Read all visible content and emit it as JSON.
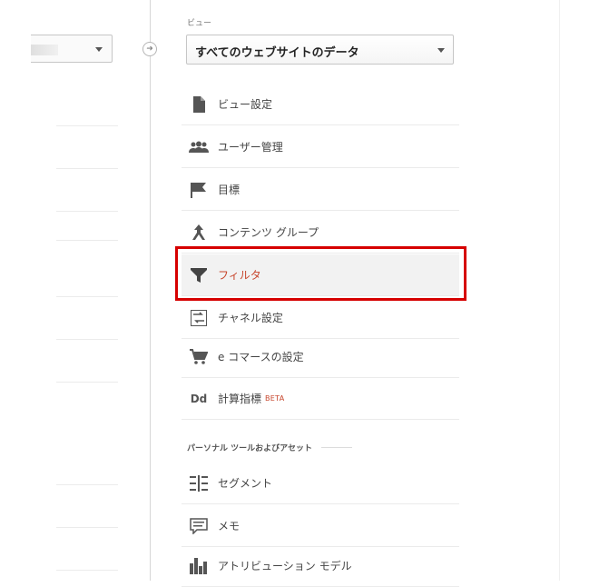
{
  "view_section": {
    "label": "ビュー",
    "selected_view": "すべてのウェブサイトのデータ"
  },
  "menu": [
    {
      "key": "view-settings",
      "label": "ビュー設定",
      "icon": "document-icon",
      "active": false
    },
    {
      "key": "user-management",
      "label": "ユーザー管理",
      "icon": "users-icon",
      "active": false
    },
    {
      "key": "goals",
      "label": "目標",
      "icon": "flag-icon",
      "active": false
    },
    {
      "key": "content-grouping",
      "label": "コンテンツ グループ",
      "icon": "merge-arrow-icon",
      "active": false
    },
    {
      "key": "filters",
      "label": "フィルタ",
      "icon": "filter-icon",
      "active": true
    },
    {
      "key": "channel-settings",
      "label": "チャネル設定",
      "icon": "channel-icon",
      "active": false
    },
    {
      "key": "ecommerce-settings",
      "label": "e コマースの設定",
      "icon": "cart-icon",
      "active": false
    },
    {
      "key": "calculated-metrics",
      "label": "計算指標",
      "badge": "BETA",
      "icon": "dd-icon",
      "active": false
    }
  ],
  "personal_tools": {
    "header": "パーソナル ツールおよびアセット",
    "items": [
      {
        "key": "segments",
        "label": "セグメント",
        "icon": "segment-icon"
      },
      {
        "key": "annotations",
        "label": "メモ",
        "icon": "note-icon"
      },
      {
        "key": "attribution-models",
        "label": "アトリビューション モデル",
        "icon": "bar-chart-icon"
      }
    ]
  },
  "icons": {
    "dd_text": "Dd"
  },
  "colors": {
    "active_text": "#c7452c",
    "highlight_border": "#d60000",
    "icon": "#555555"
  }
}
